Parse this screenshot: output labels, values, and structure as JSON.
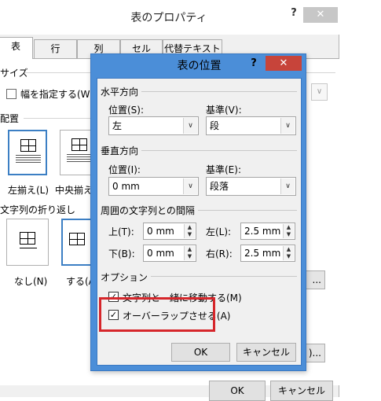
{
  "back_dialog": {
    "title": "表のプロパティ",
    "help": "?",
    "close": "✕",
    "tabs": [
      "表",
      "行",
      "列",
      "セル",
      "代替テキスト"
    ],
    "size_section": "サイズ",
    "width_checkbox_label": "幅を指定する(W):",
    "width_dropdown_arrow": "∨",
    "align_section": "配置",
    "align_left_label": "左揃え(L)",
    "align_center_label": "中央揃え",
    "wrap_section": "文字列の折り返し",
    "wrap_none_label": "なし(N)",
    "wrap_around_label": "する(A",
    "position_button_peek": "...",
    "options_button_peek": ")...",
    "ok": "OK",
    "cancel": "キャンセル"
  },
  "front_dialog": {
    "title": "表の位置",
    "help": "?",
    "close": "✕",
    "horizontal_section": "水平方向",
    "h_position_label": "位置(S):",
    "h_position_value": "左",
    "h_reference_label": "基準(V):",
    "h_reference_value": "段",
    "vertical_section": "垂直方向",
    "v_position_label": "位置(I):",
    "v_position_value": "0 mm",
    "v_reference_label": "基準(E):",
    "v_reference_value": "段落",
    "distance_section": "周囲の文字列との間隔",
    "top_label": "上(T):",
    "top_value": "0 mm",
    "left_label": "左(L):",
    "left_value": "2.5 mm",
    "bottom_label": "下(B):",
    "bottom_value": "0 mm",
    "right_label": "右(R):",
    "right_value": "2.5 mm",
    "options_section": "オプション",
    "move_with_text_label": "文字列と一緒に移動する(M)",
    "move_with_text_checked": true,
    "allow_overlap_label": "オーバーラップさせる(A)",
    "allow_overlap_checked": true,
    "check_mark": "✓",
    "ok": "OK",
    "cancel": "キャンセル"
  },
  "colors": {
    "front_frame": "#4b8ed8",
    "close_red": "#c7443a",
    "highlight_red": "#d6262b",
    "selected_blue": "#3c7fc4"
  }
}
